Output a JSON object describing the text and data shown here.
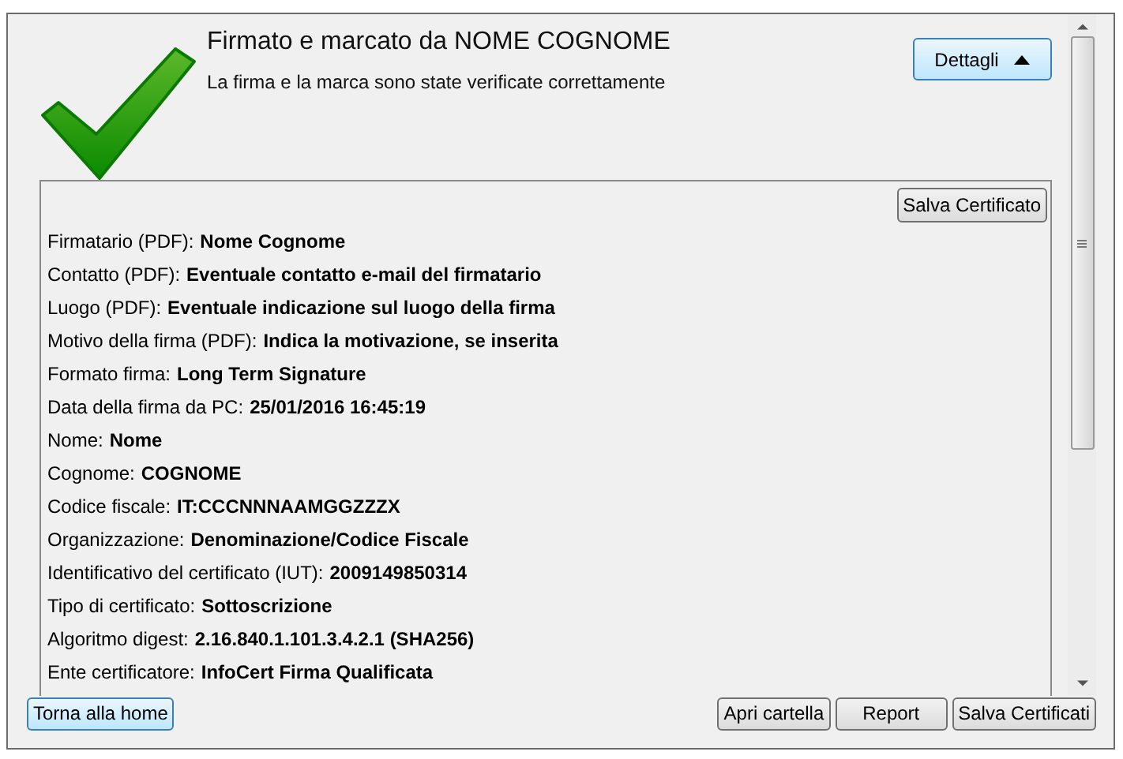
{
  "header": {
    "title": "Firmato e marcato da NOME COGNOME",
    "subtitle": "La firma e la marca sono state verificate correttamente",
    "details_button": {
      "label": "Dettagli",
      "expanded": true
    }
  },
  "details": {
    "save_button": "Salva Certificato",
    "fields": [
      {
        "label": "Firmatario (PDF):",
        "value": "Nome Cognome"
      },
      {
        "label": "Contatto (PDF):",
        "value": "Eventuale contatto e-mail  del firmatario"
      },
      {
        "label": "Luogo (PDF):",
        "value": "Eventuale indicazione sul luogo della firma"
      },
      {
        "label": "Motivo della firma (PDF):",
        "value": "Indica la motivazione, se inserita"
      },
      {
        "label": "Formato firma:",
        "value": "Long Term Signature"
      },
      {
        "label": "Data della firma da PC:",
        "value": "25/01/2016 16:45:19"
      },
      {
        "label": "Nome:",
        "value": "Nome"
      },
      {
        "label": "Cognome:",
        "value": "COGNOME"
      },
      {
        "label": "Codice fiscale:",
        "value": "IT:CCCNNNAAMGGZZZX"
      },
      {
        "label": "Organizzazione:",
        "value": "Denominazione/Codice Fiscale"
      },
      {
        "label": "Identificativo del certificato (IUT):",
        "value": "2009149850314"
      },
      {
        "label": "Tipo di certificato:",
        "value": "Sottoscrizione"
      },
      {
        "label": "Algoritmo digest:",
        "value": "2.16.840.1.101.3.4.2.1 (SHA256)"
      },
      {
        "label": "Ente certificatore:",
        "value": "InfoCert Firma Qualificata"
      }
    ]
  },
  "footer": {
    "home_button": {
      "label": "Torna alla home",
      "focused": true
    },
    "buttons": [
      "Apri cartella",
      "Report",
      "Salva Certificati"
    ]
  }
}
